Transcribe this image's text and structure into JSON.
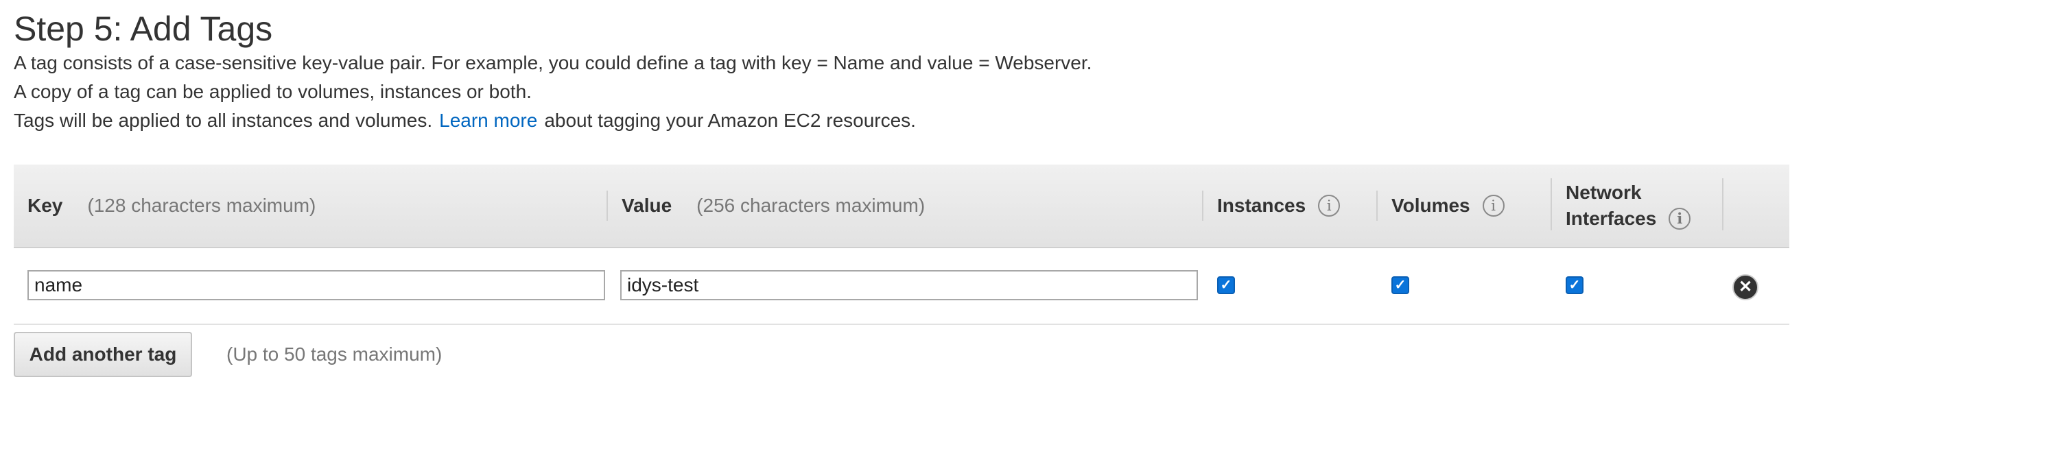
{
  "step": {
    "title": "Step 5: Add Tags"
  },
  "description": {
    "line1": "A tag consists of a case-sensitive key-value pair. For example, you could define a tag with key = Name and value = Webserver.",
    "line2": "A copy of a tag can be applied to volumes, instances or both.",
    "line3_before": "Tags will be applied to all instances and volumes.",
    "learn_more": "Learn more",
    "line3_after": "about tagging your Amazon EC2 resources."
  },
  "table": {
    "headers": {
      "key": "Key",
      "key_hint": "(128 characters maximum)",
      "value": "Value",
      "value_hint": "(256 characters maximum)",
      "instances": "Instances",
      "volumes": "Volumes",
      "network_line1": "Network",
      "network_line2": "Interfaces"
    },
    "rows": [
      {
        "key": "name",
        "value": "idys-test",
        "instances": true,
        "volumes": true,
        "network_interfaces": true
      }
    ]
  },
  "actions": {
    "add_tag_label": "Add another tag",
    "add_tag_hint": "(Up to 50 tags maximum)"
  },
  "icons": {
    "info": "info-icon",
    "check": "check-icon",
    "remove": "close-circle-icon"
  },
  "colors": {
    "link": "#0066c0",
    "checkbox": "#0a74da",
    "header_bg": "#e8e8e8"
  }
}
